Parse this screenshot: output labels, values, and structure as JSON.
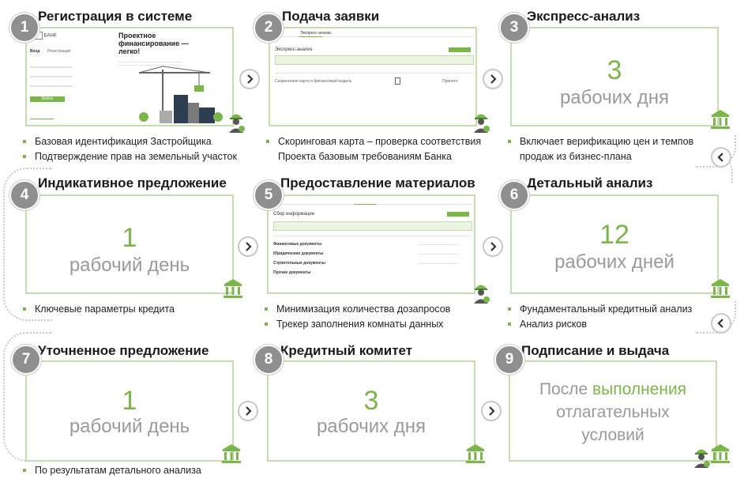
{
  "colors": {
    "accent": "#7ab648",
    "panel_border": "#c5dcae",
    "badge": "#8f8f8f",
    "muted": "#9a9a9a"
  },
  "steps": [
    {
      "num": "1",
      "title": "Регистрация в системе",
      "bullets": [
        "Базовая идентификация Застройщика",
        "Подтверждение прав на земельный участок"
      ],
      "screen": {
        "bank": "БАНК",
        "login": "Вход",
        "register": "Регистрация",
        "button": "Войти",
        "promo_line1": "Проектное",
        "promo_line2": "финансирование —",
        "promo_line3": "легко!"
      }
    },
    {
      "num": "2",
      "title": "Подача заявки",
      "bullets": [
        "Скоринговая карта – проверка соответствия",
        "Проекта базовым требованиям Банка"
      ],
      "screen": {
        "tab_active": "Экспресс-анализ",
        "section": "Экспресс-анализ",
        "row": "Скоринговая карта и финансовый модель",
        "status": "Принято"
      }
    },
    {
      "num": "3",
      "title": "Экспресс-анализ",
      "value": "3",
      "unit": "рабочих дня",
      "bullets": [
        "Включает верификацию цен и темпов",
        "продаж из бизнес-плана"
      ]
    },
    {
      "num": "4",
      "title": "Индикативное предложение",
      "value": "1",
      "unit": "рабочий день",
      "bullets": [
        "Ключевые параметры кредита"
      ]
    },
    {
      "num": "5",
      "title": "Предоставление материалов",
      "bullets": [
        "Минимизация количества дозапросов",
        "Трекер заполнения комнаты данных"
      ],
      "screen": {
        "section": "Сбор информации",
        "docs": [
          "Финансовые документы",
          "Юридические документы",
          "Строительные документы",
          "Прочие документы"
        ]
      }
    },
    {
      "num": "6",
      "title": "Детальный анализ",
      "value": "12",
      "unit": "рабочих дней",
      "bullets": [
        "Фундаментальный кредитный анализ",
        "Анализ рисков"
      ]
    },
    {
      "num": "7",
      "title": "Уточненное предложение",
      "value": "1",
      "unit": "рабочий день",
      "bullets": [
        "По результатам детального анализа"
      ]
    },
    {
      "num": "8",
      "title": "Кредитный комитет",
      "value": "3",
      "unit": "рабочих дня",
      "bullets": []
    },
    {
      "num": "9",
      "title": "Подписание и выдача",
      "conditions": {
        "before": "После ",
        "highlight": "выполнения",
        "line2": "отлагательных",
        "line3": "условий"
      },
      "bullets": []
    }
  ],
  "icons": {
    "next": "chevron-right-icon",
    "back": "chevron-left-icon",
    "bank": "bank-building-icon",
    "worker": "builder-icon"
  }
}
